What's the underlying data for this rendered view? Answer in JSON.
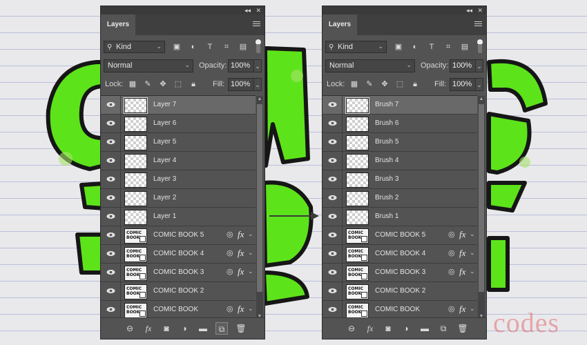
{
  "panels": [
    {
      "tab": "Layers",
      "filter": {
        "kind": "Kind"
      },
      "blend_mode": "Normal",
      "opacity_label": "Opacity:",
      "opacity": "100%",
      "lock_label": "Lock:",
      "fill_label": "Fill:",
      "fill": "100%",
      "layers": [
        {
          "name": "Layer 7",
          "thumb": "transparent",
          "selected": true,
          "fx": false
        },
        {
          "name": "Layer 6",
          "thumb": "transparent",
          "fx": false
        },
        {
          "name": "Layer 5",
          "thumb": "transparent",
          "fx": false
        },
        {
          "name": "Layer 4",
          "thumb": "transparent",
          "fx": false
        },
        {
          "name": "Layer 3",
          "thumb": "transparent",
          "fx": false
        },
        {
          "name": "Layer 2",
          "thumb": "transparent",
          "fx": false
        },
        {
          "name": "Layer 1",
          "thumb": "transparent",
          "fx": false
        },
        {
          "name": "COMIC BOOK 5",
          "thumb": "smart",
          "fx": true
        },
        {
          "name": "COMIC BOOK 4",
          "thumb": "smart",
          "fx": true
        },
        {
          "name": "COMIC BOOK 3",
          "thumb": "smart",
          "fx": true
        },
        {
          "name": "COMIC BOOK 2",
          "thumb": "smart",
          "fx": false
        },
        {
          "name": "COMIC BOOK",
          "thumb": "smart",
          "fx": true
        }
      ]
    },
    {
      "tab": "Layers",
      "filter": {
        "kind": "Kind"
      },
      "blend_mode": "Normal",
      "opacity_label": "Opacity:",
      "opacity": "100%",
      "lock_label": "Lock:",
      "fill_label": "Fill:",
      "fill": "100%",
      "layers": [
        {
          "name": "Brush 7",
          "thumb": "transparent",
          "selected": true,
          "fx": false
        },
        {
          "name": "Brush 6",
          "thumb": "transparent",
          "fx": false
        },
        {
          "name": "Brush 5",
          "thumb": "transparent",
          "fx": false
        },
        {
          "name": "Brush 4",
          "thumb": "transparent",
          "fx": false
        },
        {
          "name": "Brush 3",
          "thumb": "transparent",
          "fx": false
        },
        {
          "name": "Brush 2",
          "thumb": "transparent",
          "fx": false
        },
        {
          "name": "Brush 1",
          "thumb": "transparent",
          "fx": false
        },
        {
          "name": "COMIC BOOK 5",
          "thumb": "smart",
          "fx": true
        },
        {
          "name": "COMIC BOOK 4",
          "thumb": "smart",
          "fx": true
        },
        {
          "name": "COMIC BOOK 3",
          "thumb": "smart",
          "fx": true
        },
        {
          "name": "COMIC BOOK 2",
          "thumb": "smart",
          "fx": false
        },
        {
          "name": "COMIC BOOK",
          "thumb": "smart",
          "fx": true
        }
      ]
    }
  ],
  "thumb_text": [
    "COMIC",
    "BOOK"
  ],
  "watermark": "codes",
  "colors": {
    "panel": "#535353",
    "selected_row": "#696969",
    "comic_green": "#5fe318",
    "outline": "#1a1a1a"
  }
}
